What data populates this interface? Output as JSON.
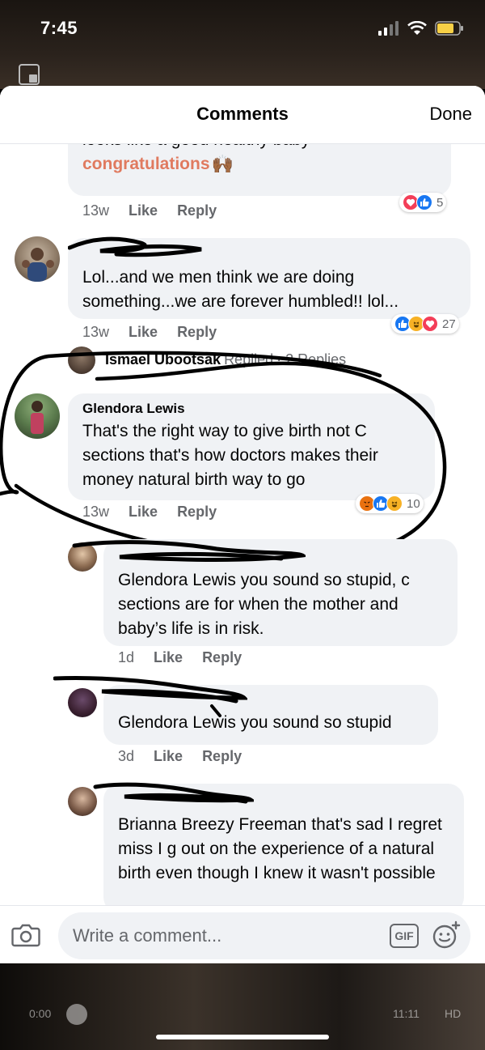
{
  "status_bar": {
    "time": "7:45"
  },
  "header": {
    "title": "Comments",
    "done_label": "Done"
  },
  "comments": [
    {
      "text_line1": "looks like a good healthy baby",
      "text_line2": "congratulations",
      "time": "13w",
      "like": "Like",
      "reply": "Reply",
      "reaction_count": "5"
    },
    {
      "text": "Lol...and we men think we are doing something...we are forever humbled!!    lol...",
      "time": "13w",
      "like": "Like",
      "reply": "Reply",
      "reaction_count": "27",
      "replies_preview": {
        "name": "Ismael Ubootsak",
        "action": "Replied",
        "count": "· 2 Replies"
      }
    },
    {
      "author": "Glendora Lewis",
      "text": "That's the right way to give birth not C sections that's how doctors makes their money natural birth way to go",
      "time": "13w",
      "like": "Like",
      "reply": "Reply",
      "reaction_count": "10"
    },
    {
      "text": "Glendora Lewis you sound so stupid, c sections are for when the mother and baby’s life is in risk.",
      "time": "1d",
      "like": "Like",
      "reply": "Reply"
    },
    {
      "text": "Glendora Lewis you sound so stupid",
      "time": "3d",
      "like": "Like",
      "reply": "Reply"
    },
    {
      "text": "Brianna Breezy Freeman that's sad I regret miss I g out on the experience of a natural birth even though I knew it wasn't possible"
    }
  ],
  "composer": {
    "placeholder": "Write a comment...",
    "gif_label": "GIF"
  },
  "video": {
    "elapsed": "0:00",
    "duration": "11:11",
    "quality": "HD"
  },
  "colors": {
    "accent_orange": "#e07a5f",
    "like_blue": "#1877f2",
    "heart_red": "#f33e58",
    "bubble": "#f0f2f5"
  }
}
